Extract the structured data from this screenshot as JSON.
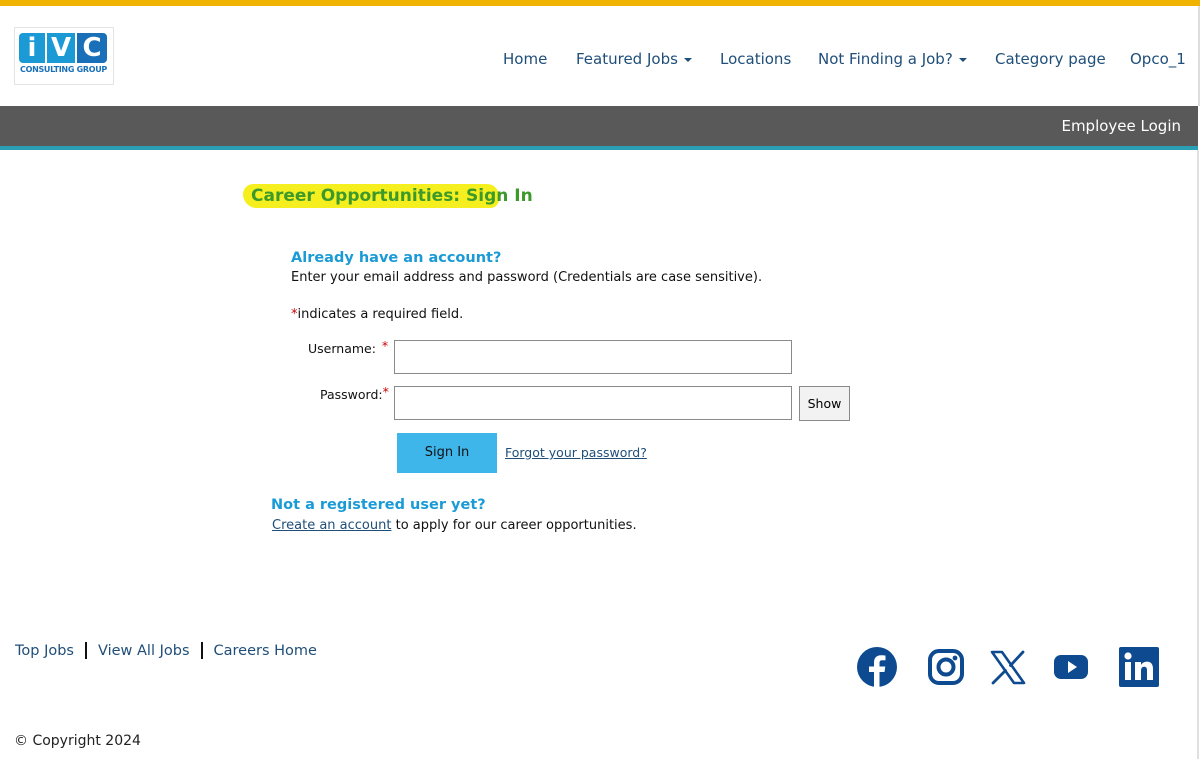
{
  "brand": {
    "logo_letters": [
      "i",
      "V",
      "C"
    ],
    "logo_subtitle": "CONSULTING GROUP",
    "accent_top": "#f0b400",
    "nav_color": "#1f4e79",
    "heading_blue": "#1a9bd6"
  },
  "nav": {
    "home": "Home",
    "featured_jobs": "Featured Jobs",
    "locations": "Locations",
    "not_finding": "Not Finding a Job?",
    "category_page": "Category page",
    "opco": "Opco_1"
  },
  "subheader": {
    "employee_login": "Employee Login"
  },
  "main": {
    "page_title": "Career Opportunities: Sign In",
    "account_heading": "Already have an account?",
    "account_instructions": "Enter your email address and password (Credentials are case sensitive).",
    "required_star": "*",
    "required_note": "indicates a required field.",
    "username_label": "Username:",
    "password_label": "Password:",
    "username_value": "",
    "password_value": "",
    "show_button": "Show",
    "signin_button": "Sign In",
    "forgot_link": "Forgot your password?",
    "register_heading": "Not a registered user yet?",
    "create_account_link": "Create an account",
    "create_account_suffix": " to apply for our career opportunities."
  },
  "footer": {
    "links": [
      "Top Jobs",
      "View All Jobs",
      "Careers Home"
    ],
    "social_icons": [
      "facebook-icon",
      "instagram-icon",
      "x-icon",
      "youtube-icon",
      "linkedin-icon"
    ],
    "copyright": "© Copyright 2024"
  }
}
